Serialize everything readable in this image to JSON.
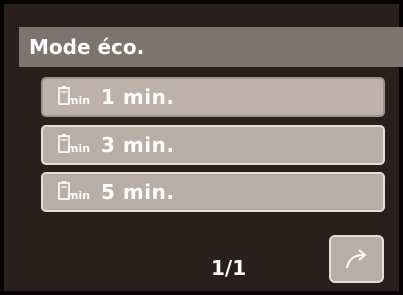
{
  "header": {
    "title": "Mode éco."
  },
  "options": [
    {
      "unit": "min",
      "label": "1 min.",
      "icon": "sleep-timer-icon"
    },
    {
      "unit": "min",
      "label": "3 min.",
      "icon": "sleep-timer-icon"
    },
    {
      "unit": "min",
      "label": "5 min.",
      "icon": "sleep-timer-icon"
    }
  ],
  "footer": {
    "page": "1/1",
    "back_icon": "return-arrow-icon"
  },
  "colors": {
    "background": "#2a1f1d",
    "titlebar": "#7d7470",
    "option_bg": "#b9aea6",
    "option_border": "#e6ddd6"
  }
}
